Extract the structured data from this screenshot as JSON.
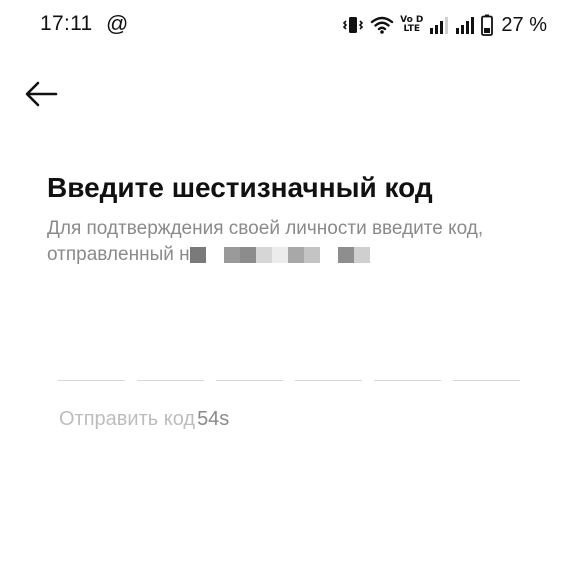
{
  "status_bar": {
    "time": "17:11",
    "notification_icon": "at-sign-icon",
    "volte_line1": "Vo D",
    "volte_line2": "LTE",
    "battery_percent": "27 %"
  },
  "header": {
    "back_icon": "arrow-left-icon"
  },
  "main": {
    "title": "Введите шестизначный код",
    "subtitle_prefix": "Для подтверждения своей личности введите код, отправленный н",
    "code_cells": 6,
    "resend_label": "Отправить код",
    "resend_timer": "54s"
  },
  "colors": {
    "text": "#111111",
    "secondary": "#8a8a8a",
    "disabled": "#bdbdbd",
    "underline": "#d8d8d8"
  }
}
